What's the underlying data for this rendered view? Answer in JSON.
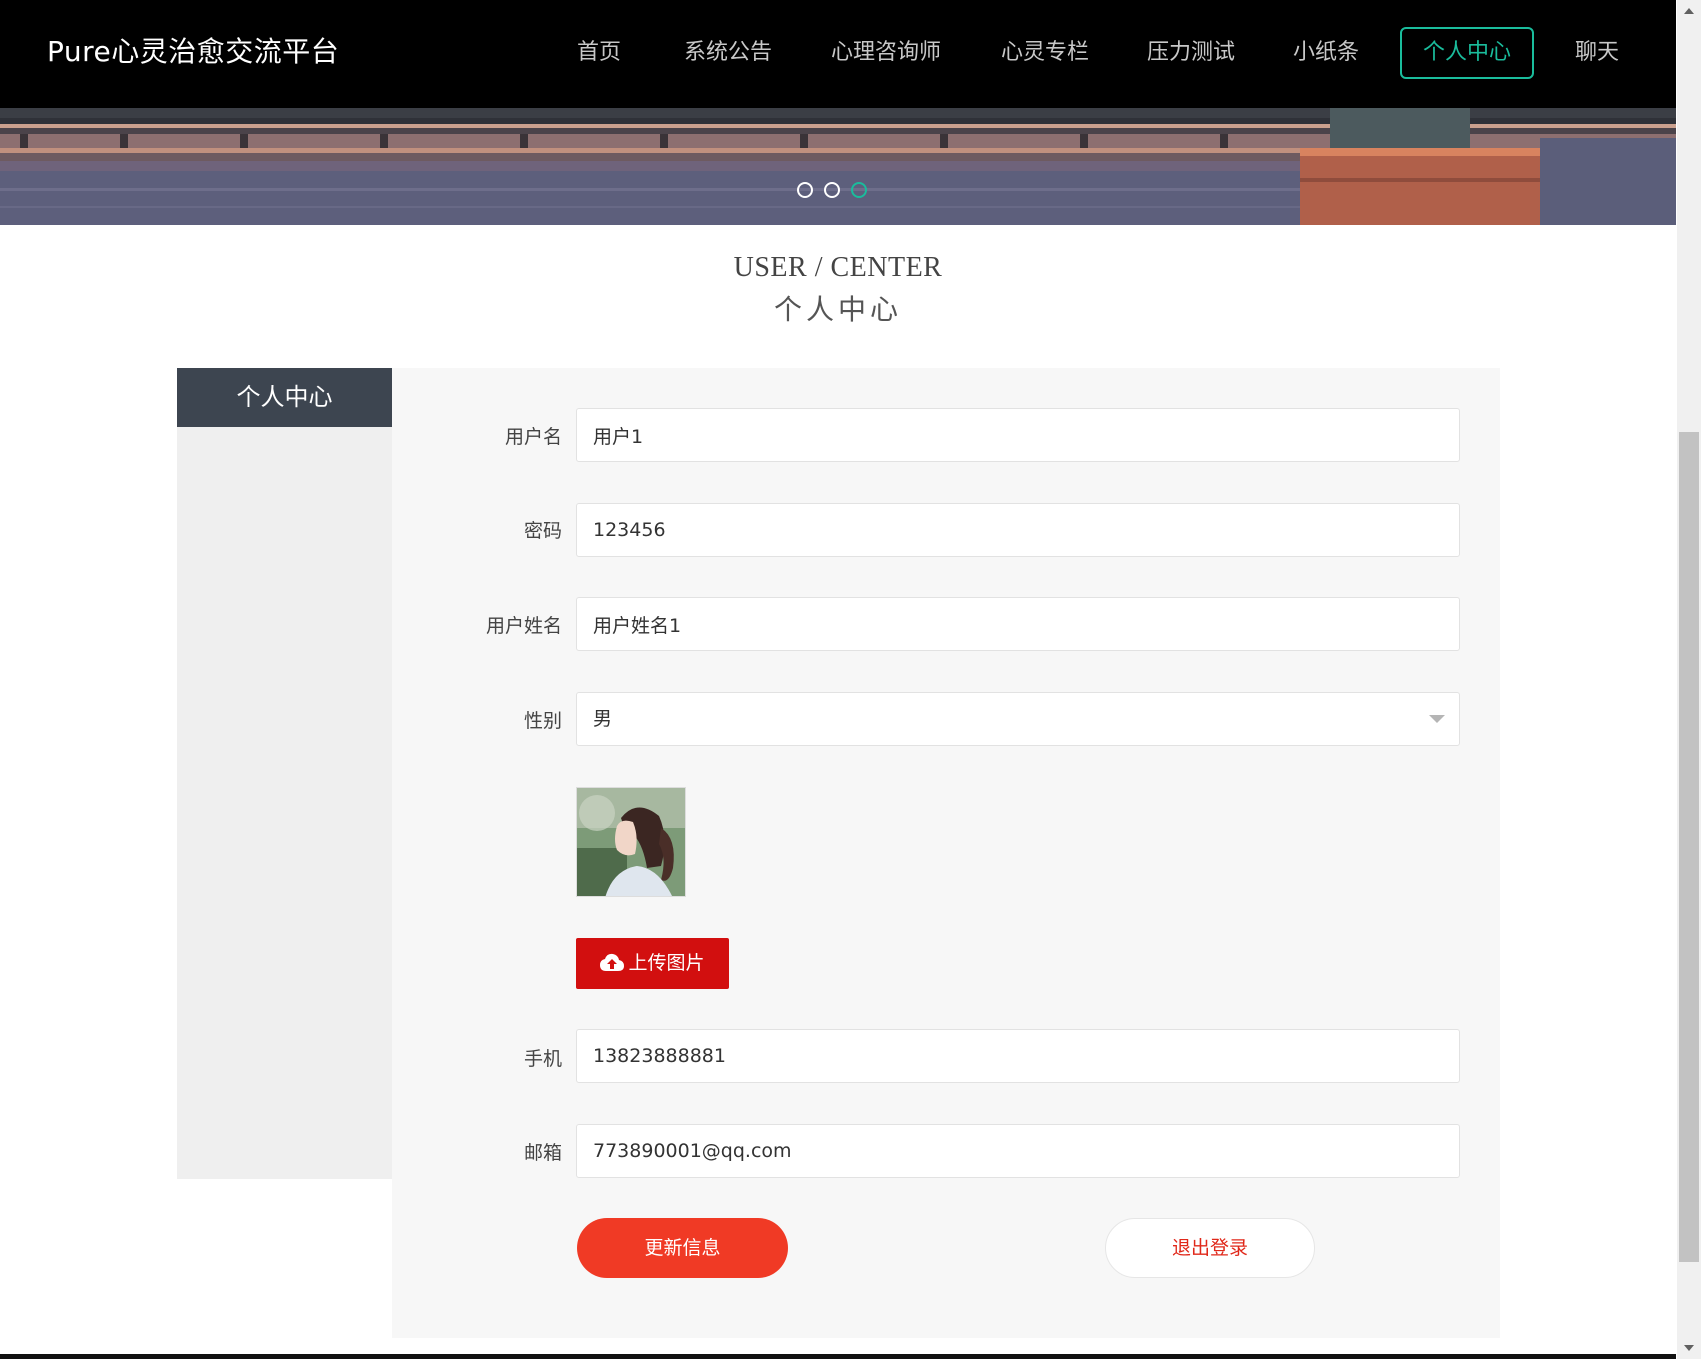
{
  "header": {
    "brand": "Pure心灵治愈交流平台",
    "nav": [
      {
        "label": "首页",
        "active": false
      },
      {
        "label": "系统公告",
        "active": false
      },
      {
        "label": "心理咨询师",
        "active": false
      },
      {
        "label": "心灵专栏",
        "active": false
      },
      {
        "label": "压力测试",
        "active": false
      },
      {
        "label": "小纸条",
        "active": false
      },
      {
        "label": "个人中心",
        "active": true
      },
      {
        "label": "聊天",
        "active": false
      }
    ]
  },
  "banner": {
    "slides": 3,
    "active_slide": 3
  },
  "section": {
    "title_en": "USER / CENTER",
    "title_cn": "个人中心"
  },
  "sidebar": {
    "title": "个人中心"
  },
  "form": {
    "username": {
      "label": "用户名",
      "value": "用户1"
    },
    "password": {
      "label": "密码",
      "value": "123456"
    },
    "realname": {
      "label": "用户姓名",
      "value": "用户姓名1"
    },
    "gender": {
      "label": "性别",
      "value": "男"
    },
    "upload_label": "上传图片",
    "phone": {
      "label": "手机",
      "value": "13823888881"
    },
    "email": {
      "label": "邮箱",
      "value": "773890001@qq.com"
    },
    "update_button": "更新信息",
    "logout_button": "退出登录"
  },
  "colors": {
    "accent": "#1abc9c",
    "header_bg": "#000000",
    "upload_red": "#d20f0f",
    "update_red": "#f03a25",
    "sidebar_head": "#3d4550"
  }
}
